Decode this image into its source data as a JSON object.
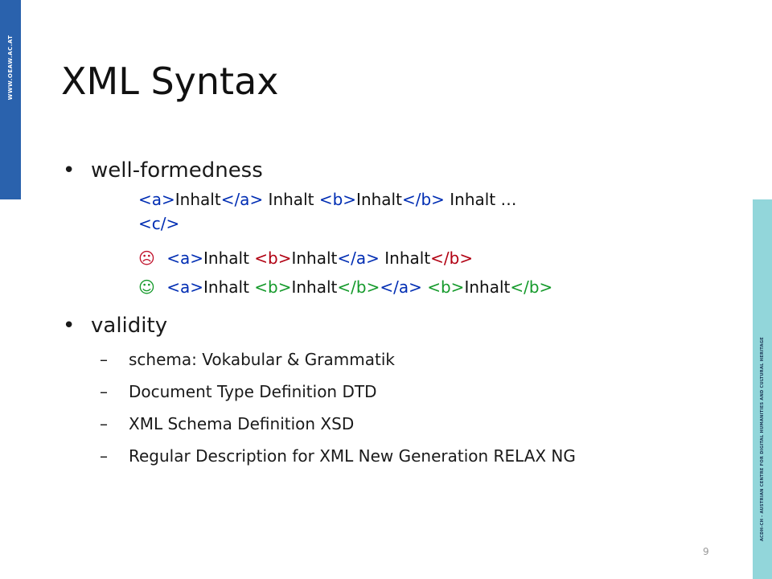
{
  "sidebar_left": {
    "text": "WWW.OEAW.AC.AT"
  },
  "sidebar_right": {
    "text": "ACDH-CH - AUSTRIAN CENTRE FOR DIGITAL HUMANITIES AND CULTURAL HERITAGE"
  },
  "title": "XML Syntax",
  "colors": {
    "left_strip": "#2a62ad",
    "right_strip": "#92d6da",
    "tag_blue": "#002db3",
    "tag_red": "#b10012",
    "tag_green": "#159a2b"
  },
  "bullets": [
    {
      "label": "well-formedness",
      "lines": [
        [
          {
            "text": "<a>",
            "color": "blue"
          },
          {
            "text": "Inhalt",
            "color": "black"
          },
          {
            "text": "</a>",
            "color": "blue"
          },
          {
            "text": " Inhalt ",
            "color": "black"
          },
          {
            "text": "<b>",
            "color": "blue"
          },
          {
            "text": "Inhalt",
            "color": "black"
          },
          {
            "text": "</b>",
            "color": "blue"
          },
          {
            "text": " Inhalt …",
            "color": "black"
          }
        ],
        [
          {
            "text": "<c/>",
            "color": "blue"
          }
        ]
      ],
      "bad_example": {
        "icon": "sad-face-icon",
        "parts": [
          {
            "text": "<a>",
            "color": "blue"
          },
          {
            "text": "Inhalt ",
            "color": "black"
          },
          {
            "text": "<b>",
            "color": "red"
          },
          {
            "text": "Inhalt",
            "color": "black"
          },
          {
            "text": "</a>",
            "color": "blue"
          },
          {
            "text": " Inhalt",
            "color": "black"
          },
          {
            "text": "</b>",
            "color": "red"
          }
        ]
      },
      "good_example": {
        "icon": "happy-face-icon",
        "parts": [
          {
            "text": "<a>",
            "color": "blue"
          },
          {
            "text": "Inhalt ",
            "color": "black"
          },
          {
            "text": "<b>",
            "color": "green"
          },
          {
            "text": "Inhalt",
            "color": "black"
          },
          {
            "text": "</b>",
            "color": "green"
          },
          {
            "text": "</a>",
            "color": "blue"
          },
          {
            "text": " ",
            "color": "black"
          },
          {
            "text": "<b>",
            "color": "green"
          },
          {
            "text": "Inhalt",
            "color": "black"
          },
          {
            "text": "</b>",
            "color": "green"
          }
        ]
      }
    },
    {
      "label": "validity",
      "subitems": [
        "schema: Vokabular & Grammatik",
        "Document Type Definition DTD",
        "XML Schema Definition XSD",
        "Regular Description for XML New Generation RELAX NG"
      ]
    }
  ],
  "page_number": "9"
}
